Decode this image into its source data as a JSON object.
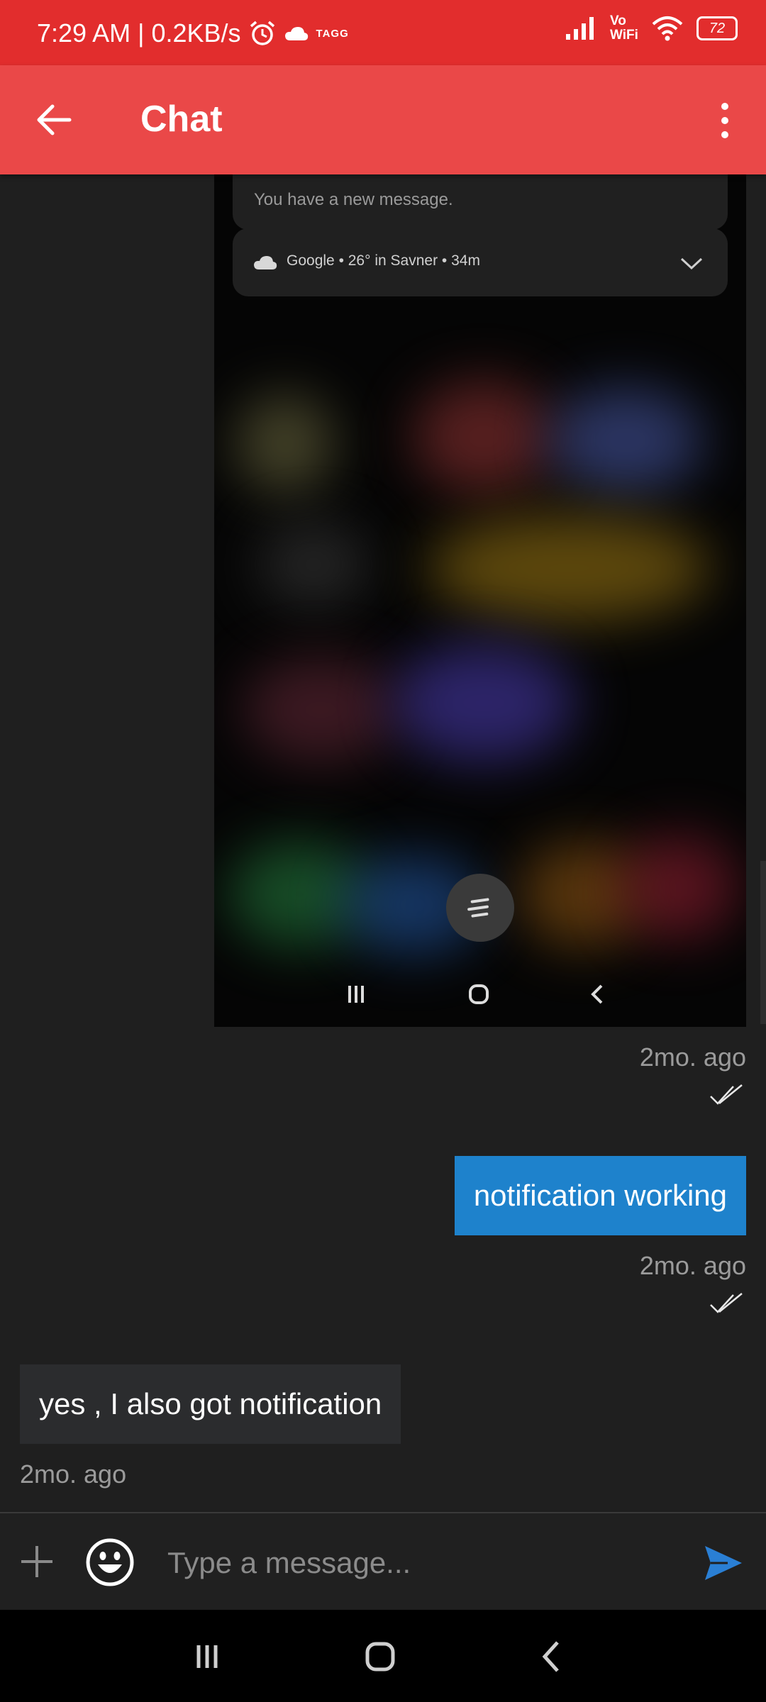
{
  "status_bar": {
    "time_speed": "7:29 AM | 0.2KB/s",
    "brand_badge": "TAGG",
    "vowifi": "Vo WiFi",
    "battery": "72"
  },
  "app_bar": {
    "title": "Chat",
    "back_icon": "arrow-left-icon",
    "menu_icon": "more-vert-icon"
  },
  "shared_screenshot": {
    "notification_text": "You have a new message.",
    "weather": {
      "source": "Google",
      "temp": "26° in Savner",
      "age": "34m"
    }
  },
  "messages": [
    {
      "type": "image",
      "direction": "outgoing",
      "time": "2mo. ago",
      "status": "read"
    },
    {
      "type": "text",
      "direction": "outgoing",
      "text": "notification working",
      "time": "2mo. ago",
      "status": "read"
    },
    {
      "type": "text",
      "direction": "incoming",
      "text": "yes , I also got notification",
      "time": "2mo. ago"
    }
  ],
  "input": {
    "placeholder": "Type a message..."
  },
  "colors": {
    "status_bar": "#e22d2d",
    "app_bar": "#ea4848",
    "outgoing_bubble": "#1e82cc",
    "incoming_bubble": "#2b2c2e",
    "background": "#1f1f1f",
    "send_icon": "#2a7fd4"
  }
}
